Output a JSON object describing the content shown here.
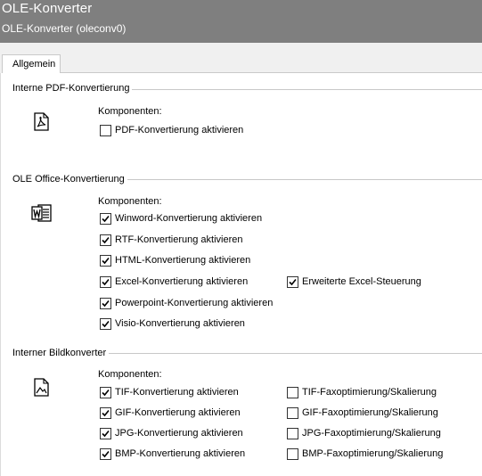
{
  "window": {
    "title": "OLE-Konverter",
    "subtitle": "OLE-Konverter (oleconv0)"
  },
  "tabs": [
    {
      "label": "Allgemein",
      "active": true
    }
  ],
  "groups": {
    "pdf": {
      "title": "Interne PDF-Konvertierung",
      "icon": "pdf-document-icon",
      "components_label": "Komponenten:",
      "options": [
        {
          "label": "PDF-Konvertierung aktivieren",
          "checked": false
        }
      ]
    },
    "office": {
      "title": "OLE Office-Konvertierung",
      "icon": "word-document-icon",
      "components_label": "Komponenten:",
      "options": [
        {
          "label": "Winword-Konvertierung aktivieren",
          "checked": true
        },
        {
          "label": "RTF-Konvertierung aktivieren",
          "checked": true
        },
        {
          "label": "HTML-Konvertierung aktivieren",
          "checked": true
        },
        {
          "label": "Excel-Konvertierung aktivieren",
          "checked": true
        },
        {
          "label": "Powerpoint-Konvertierung aktivieren",
          "checked": true
        },
        {
          "label": "Visio-Konvertierung aktivieren",
          "checked": true
        }
      ],
      "extra_option": {
        "label": "Erweiterte Excel-Steuerung",
        "checked": true
      }
    },
    "image": {
      "title": "Interner Bildkonverter",
      "icon": "image-document-icon",
      "components_label": "Komponenten:",
      "options": [
        {
          "label": "TIF-Konvertierung aktivieren",
          "checked": true
        },
        {
          "label": "GIF-Konvertierung aktivieren",
          "checked": true
        },
        {
          "label": "JPG-Konvertierung aktivieren",
          "checked": true
        },
        {
          "label": "BMP-Konvertierung aktivieren",
          "checked": true
        }
      ],
      "fax_options": [
        {
          "label": "TIF-Faxoptimierung/Skalierung",
          "checked": false
        },
        {
          "label": "GIF-Faxoptimierung/Skalierung",
          "checked": false
        },
        {
          "label": "JPG-Faxoptimierung/Skalierung",
          "checked": false
        },
        {
          "label": "BMP-Faxoptimierung/Skalierung",
          "checked": false
        }
      ]
    }
  },
  "colors": {
    "titlebar": "#7f7f7f",
    "tabstrip": "#f0f0f0"
  }
}
